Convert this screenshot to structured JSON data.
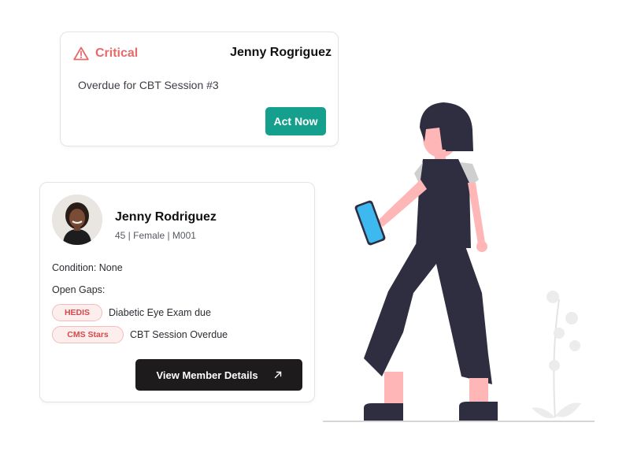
{
  "alert": {
    "severity": "Critical",
    "patient_name": "Jenny Rogriguez",
    "message": "Overdue for CBT Session #3",
    "action_label": "Act Now",
    "colors": {
      "severity": "#e76a6a",
      "action": "#14a08c"
    }
  },
  "member": {
    "name": "Jenny Rodriguez",
    "meta": "45 | Female | M001",
    "condition_label": "Condition:",
    "condition_value": "None",
    "open_gaps_label": "Open Gaps:",
    "gaps": [
      {
        "badge": "HEDIS",
        "text": "Diabetic Eye Exam due"
      },
      {
        "badge": "CMS Stars",
        "text": "CBT Session Overdue"
      }
    ],
    "details_button_label": "View Member Details",
    "colors": {
      "badge_text": "#d84848",
      "badge_bg": "#fdeeee",
      "button_bg": "#1e1b1c"
    }
  },
  "icons": {
    "alert": "warning-triangle-icon",
    "details": "arrow-up-right-icon"
  }
}
